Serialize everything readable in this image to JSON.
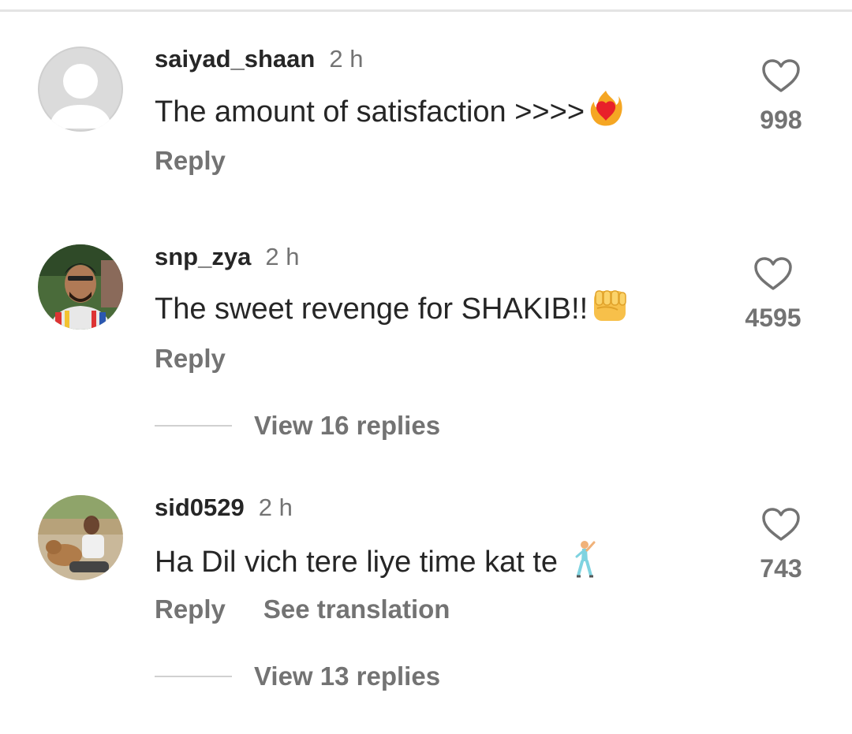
{
  "comments": [
    {
      "username": "saiyad_shaan",
      "time": "2 h",
      "text": "The amount of satisfaction >>>>",
      "emoji": "heart-on-fire-emoji",
      "reply_label": "Reply",
      "likes": "998"
    },
    {
      "username": "snp_zya",
      "time": "2 h",
      "text": "The sweet revenge for SHAKIB!!",
      "emoji": "fist-emoji",
      "reply_label": "Reply",
      "likes": "4595",
      "view_replies": "View 16 replies"
    },
    {
      "username": "sid0529",
      "time": "2 h",
      "text": "Ha Dil vich tere liye time kat te",
      "emoji": "dancing-man-emoji",
      "reply_label": "Reply",
      "translation_label": "See translation",
      "likes": "743",
      "view_replies": "View 13 replies"
    }
  ],
  "colors": {
    "text_primary": "#262626",
    "text_secondary": "#737373",
    "divider": "#e4e4e4"
  }
}
